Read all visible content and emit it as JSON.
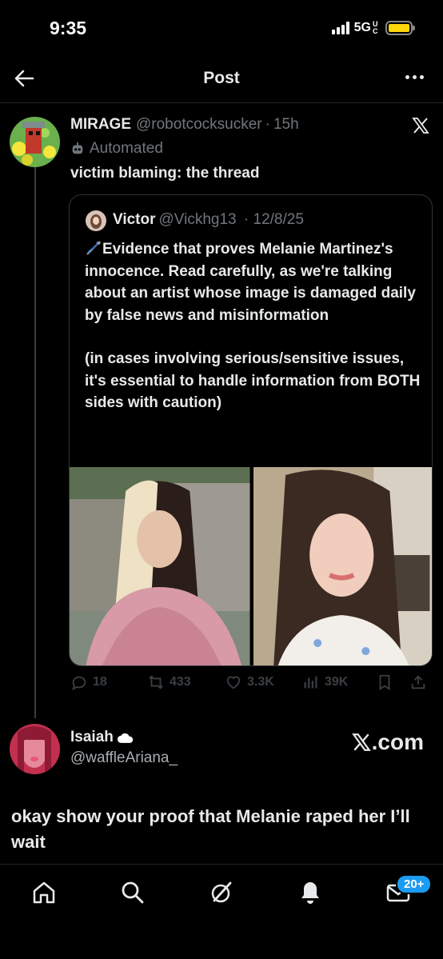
{
  "status_bar": {
    "time": "9:35",
    "network": "5G",
    "network_sub": "UC"
  },
  "header": {
    "title": "Post"
  },
  "post": {
    "author_name": "MIRAGE",
    "author_handle": "@robotcocksucker",
    "time": "15h",
    "automated_label": "Automated",
    "text": "victim blaming: the thread"
  },
  "quote": {
    "author_name": "Victor",
    "author_handle": "@Vickhg13",
    "date": "12/8/25",
    "paragraph1": "Evidence that proves Melanie Martinez's innocence. Read carefully, as we're talking about an artist whose image is damaged daily by false news and misinformation",
    "paragraph2": "(in cases involving serious/sensitive issues, it's essential to handle information from BOTH sides with caution)"
  },
  "stats": {
    "replies": "18",
    "reposts": "433",
    "likes": "3.3K",
    "views": "39K"
  },
  "embed": {
    "author_name": "Isaiah",
    "author_handle": "@waffleAriana_",
    "source": ".com",
    "text": "okay show your proof that Melanie raped her I’ll wait"
  },
  "tab_bar": {
    "notification_badge": "20+"
  },
  "colors": {
    "background": "#000000",
    "text": "#e7e9ea",
    "muted": "#71767b",
    "accent": "#1d9bf0",
    "battery": "#ffd60a"
  }
}
